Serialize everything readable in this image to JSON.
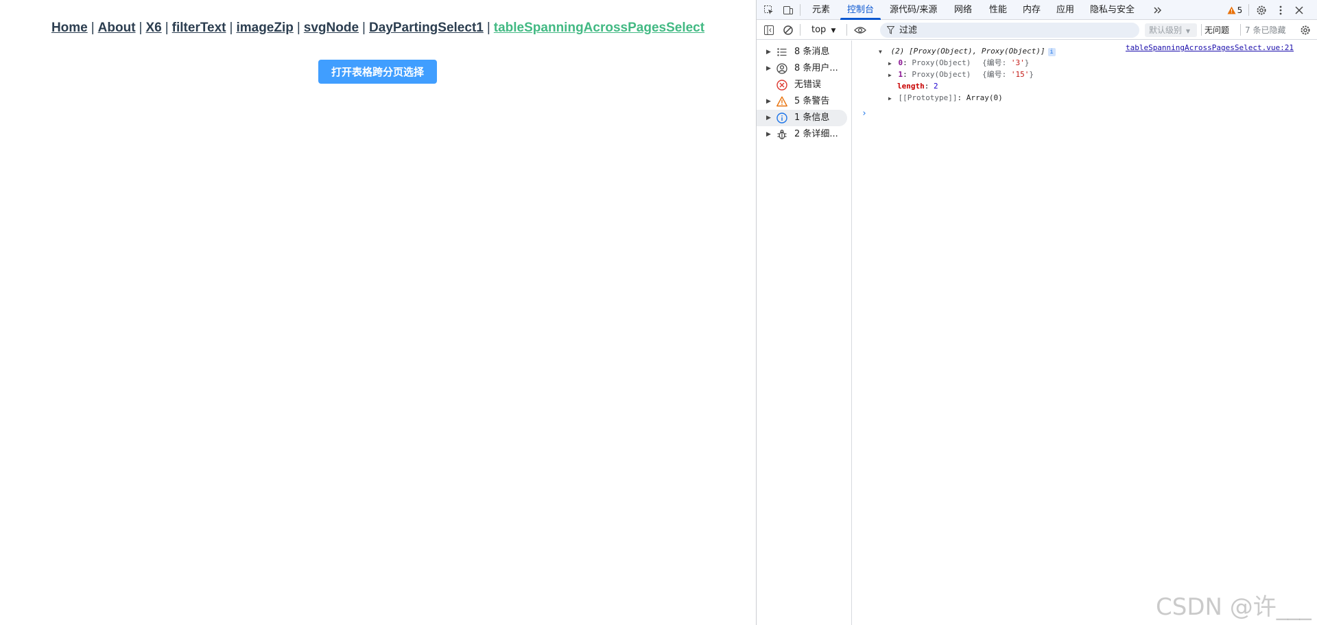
{
  "nav": {
    "links": [
      {
        "label": "Home",
        "active": false
      },
      {
        "label": "About",
        "active": false
      },
      {
        "label": "X6",
        "active": false
      },
      {
        "label": "filterText",
        "active": false
      },
      {
        "label": "imageZip",
        "active": false
      },
      {
        "label": "svgNode",
        "active": false
      },
      {
        "label": "DayPartingSelect1",
        "active": false
      },
      {
        "label": "tableSpanningAcrossPagesSelect",
        "active": true
      }
    ],
    "separator": "|"
  },
  "main": {
    "open_button_label": "打开表格跨分页选择"
  },
  "devtools": {
    "tabs": [
      "元素",
      "控制台",
      "源代码/来源",
      "网络",
      "性能",
      "内存",
      "应用",
      "隐私与安全"
    ],
    "active_tab": "控制台",
    "warning_count": "5",
    "toolbar": {
      "context": "top",
      "filter_placeholder": "过滤",
      "levels": "默认级别",
      "no_issues": "无问题",
      "hidden": "7 条已隐藏"
    },
    "sidebar": [
      {
        "label": "8 条消息",
        "icon": "list-icon",
        "expandable": true
      },
      {
        "label": "8 条用户...",
        "icon": "user-icon",
        "expandable": true
      },
      {
        "label": "无错误",
        "icon": "error-icon",
        "expandable": false
      },
      {
        "label": "5 条警告",
        "icon": "warning-icon",
        "expandable": true
      },
      {
        "label": "1 条信息",
        "icon": "info-icon",
        "expandable": true
      },
      {
        "label": "2 条详细...",
        "icon": "bug-icon",
        "expandable": true
      }
    ],
    "console": {
      "source_link": "tableSpanningAcrossPagesSelect.vue:21",
      "summary": "(2) [Proxy(Object), Proxy(Object)]",
      "info_badge": "i",
      "items": [
        {
          "index": "0",
          "type": "Proxy(Object)",
          "preview_key": "编号",
          "preview_value": "'3'"
        },
        {
          "index": "1",
          "type": "Proxy(Object)",
          "preview_key": "编号",
          "preview_value": "'15'"
        }
      ],
      "length_key": "length",
      "length_value": "2",
      "prototype_key": "[[Prototype]]",
      "prototype_value": "Array(0)",
      "prompt": "›"
    },
    "colors": {
      "accent": "#0b57d0",
      "warning": "#e8710a",
      "error": "#dc362e",
      "info": "#1a73e8"
    }
  },
  "watermark": "CSDN @许___",
  "colors": {
    "vue_green": "#42b983",
    "nav_text": "#2c3e50",
    "button_blue": "#409eff"
  }
}
